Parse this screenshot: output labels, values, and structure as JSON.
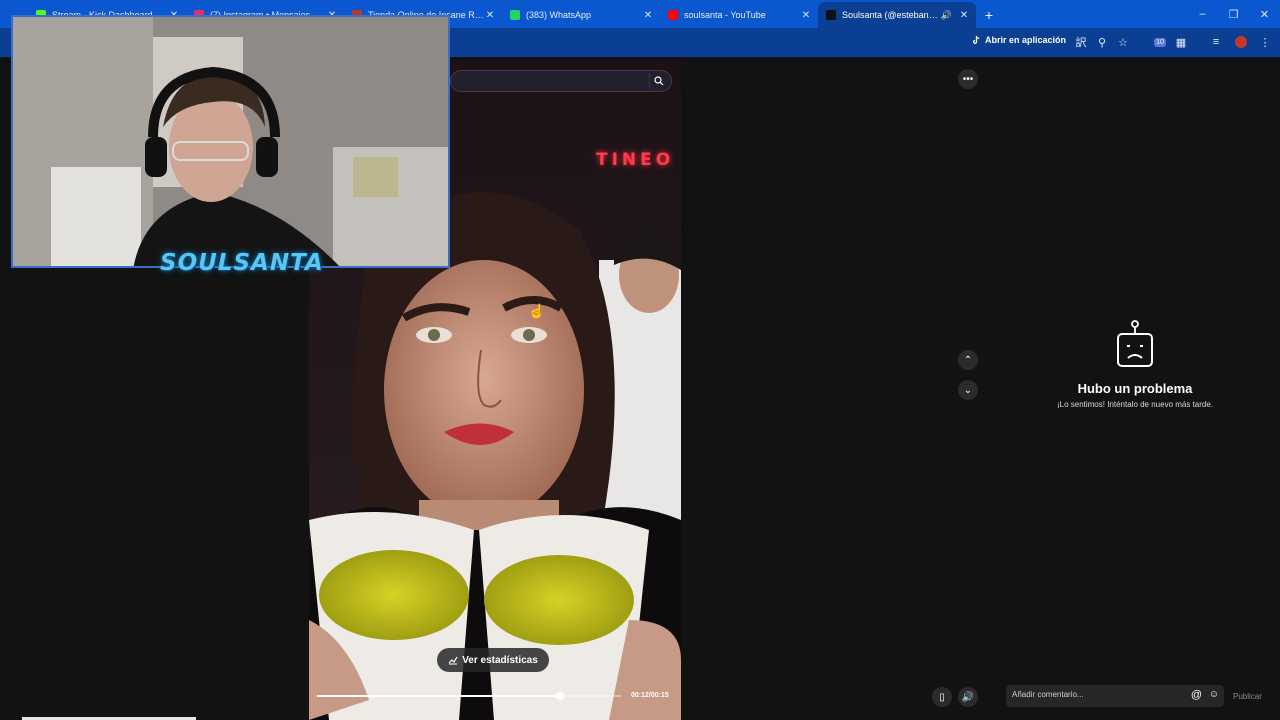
{
  "browser": {
    "tabs": [
      {
        "title": "Stream - Kick Dashboard",
        "favicon_color": "#53fc18",
        "active": false
      },
      {
        "title": "(7) Instagram • Mensajes",
        "favicon_color": "#e1306c",
        "active": false
      },
      {
        "title": "Tienda Online de Insane Roots",
        "favicon_color": "#b23b2a",
        "active": false
      },
      {
        "title": "(383) WhatsApp",
        "favicon_color": "#25d366",
        "active": false
      },
      {
        "title": "soulsanta - YouTube",
        "favicon_color": "#ff0000",
        "active": false
      },
      {
        "title": "Soulsanta (@estebansantana",
        "favicon_color": "#111111",
        "active": true
      }
    ],
    "new_tab_glyph": "+",
    "toolbar": {
      "open_app_label": "Abrir en aplicación",
      "extension_badge": "10"
    },
    "accent_color": "#0b57d0"
  },
  "video": {
    "neon_sign_text": "TINEO",
    "stats_button_label": "Ver estadísticas",
    "progress_fraction": 0.8,
    "time_readout": "00:12/00:15"
  },
  "webcam": {
    "brand_text": "SOULSANTA"
  },
  "comments_panel": {
    "error_title": "Hubo un problema",
    "error_subtitle": "¡Lo sentimos! Inténtalo de nuevo más tarde.",
    "comment_placeholder": "Añadir comentario...",
    "publish_label": "Publicar"
  },
  "icons": {
    "more": "more-options-icon",
    "up": "chevron-up-icon",
    "down": "chevron-down-icon",
    "robot": "sad-robot-icon"
  }
}
